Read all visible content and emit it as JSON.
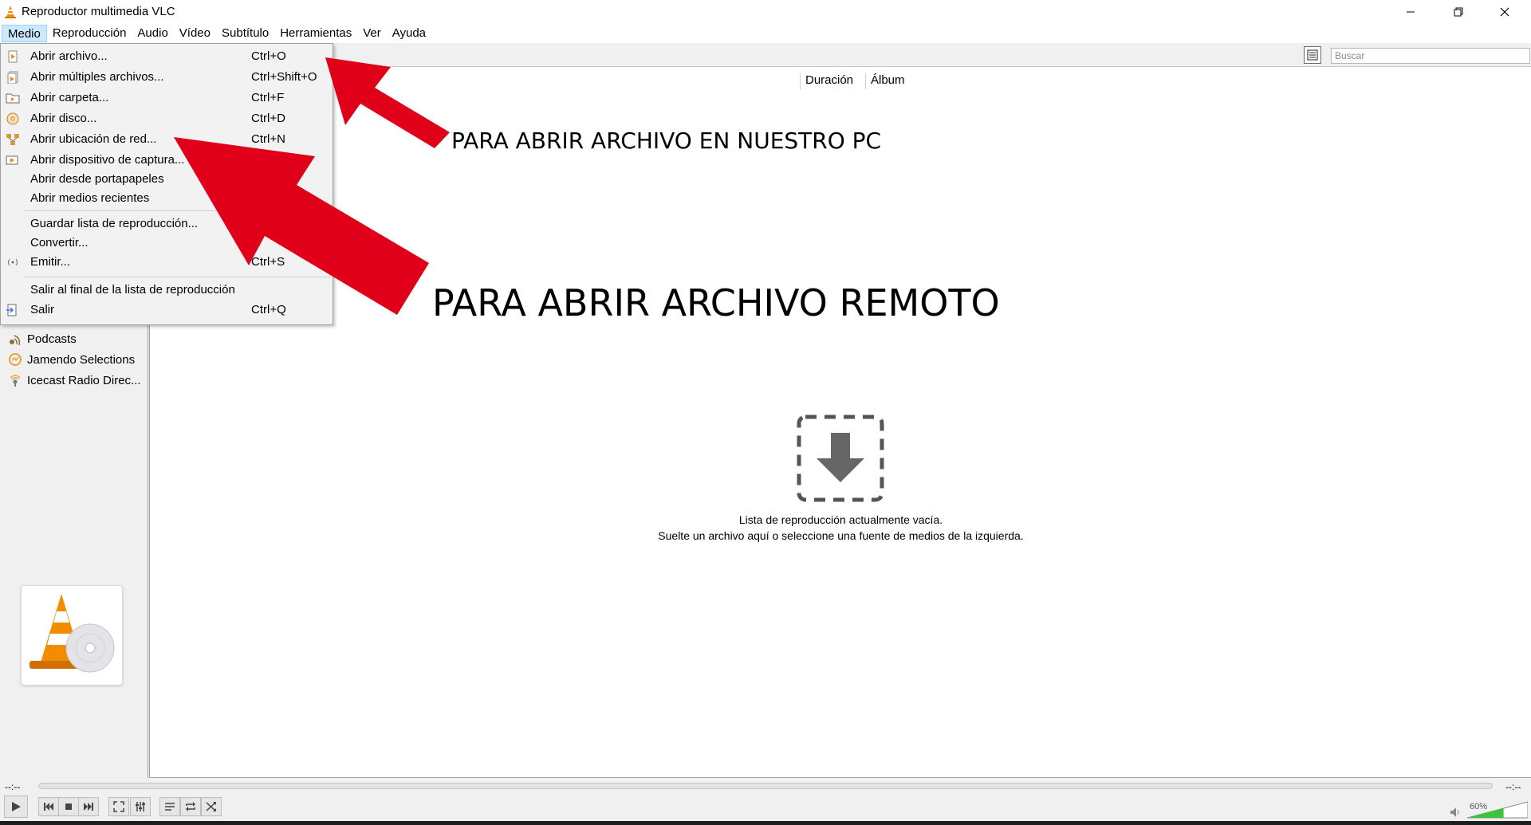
{
  "window": {
    "title": "Reproductor multimedia VLC"
  },
  "menubar": {
    "items": [
      "Medio",
      "Reproducción",
      "Audio",
      "Vídeo",
      "Subtítulo",
      "Herramientas",
      "Ver",
      "Ayuda"
    ]
  },
  "dropdown": {
    "items": [
      {
        "label": "Abrir archivo...",
        "shortcut": "Ctrl+O",
        "icon": "file-icon"
      },
      {
        "label": "Abrir múltiples archivos...",
        "shortcut": "Ctrl+Shift+O",
        "icon": "files-icon"
      },
      {
        "label": "Abrir carpeta...",
        "shortcut": "Ctrl+F",
        "icon": "folder-icon"
      },
      {
        "label": "Abrir disco...",
        "shortcut": "Ctrl+D",
        "icon": "disc-icon"
      },
      {
        "label": "Abrir ubicación de red...",
        "shortcut": "Ctrl+N",
        "icon": "network-icon"
      },
      {
        "label": "Abrir dispositivo de captura...",
        "shortcut": "",
        "icon": "capture-icon"
      },
      {
        "label": "Abrir desde portapapeles",
        "shortcut": "",
        "icon": ""
      },
      {
        "label": "Abrir medios recientes",
        "shortcut": "",
        "icon": ""
      },
      {
        "label": "Guardar lista de reproducción...",
        "shortcut": "",
        "icon": ""
      },
      {
        "label": "Convertir...",
        "shortcut": "",
        "icon": ""
      },
      {
        "label": "Emitir...",
        "shortcut": "Ctrl+S",
        "icon": "stream-icon"
      },
      {
        "label": "Salir al final de la lista de reproducción",
        "shortcut": "",
        "icon": ""
      },
      {
        "label": "Salir",
        "shortcut": "Ctrl+Q",
        "icon": "exit-icon"
      }
    ]
  },
  "sidebar": {
    "items": [
      "Podcasts",
      "Jamendo Selections",
      "Icecast Radio Direc..."
    ]
  },
  "toolbar": {
    "search_placeholder": "Buscar"
  },
  "playlist": {
    "columns": [
      "Duración",
      "Álbum"
    ],
    "empty_line1": "Lista de reproducción actualmente vacía.",
    "empty_line2": "Suelte un archivo aquí o seleccione una fuente de medios de la izquierda."
  },
  "annotations": {
    "first": "PARA ABRIR ARCHIVO EN NUESTRO PC",
    "second": "PARA ABRIR ARCHIVO REMOTO"
  },
  "controls": {
    "time_elapsed": "--:--",
    "time_total": "--:--",
    "volume": "60%",
    "volume_level": 0.6
  },
  "colors": {
    "arrow": "#e0001a",
    "menu_highlight": "#cce8ff",
    "vlc_orange": "#f28c00",
    "volume_green": "#3cc43c"
  }
}
